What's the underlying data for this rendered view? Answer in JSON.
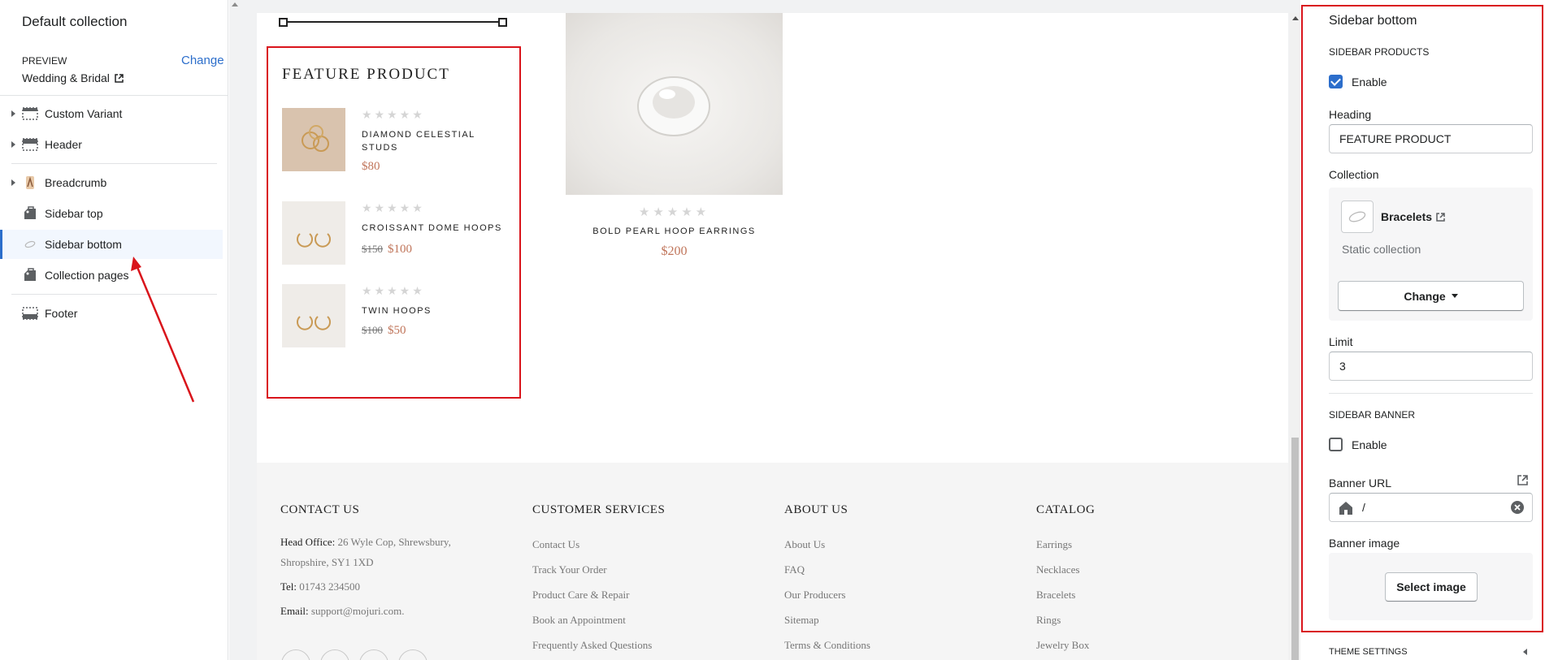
{
  "left_panel": {
    "collection_title": "Default collection",
    "preview_label": "PREVIEW",
    "preview_change": "Change",
    "preview_value": "Wedding & Bridal",
    "items": [
      {
        "label": "Custom Variant",
        "icon": "section-icon",
        "expandable": true
      },
      {
        "label": "Header",
        "icon": "header-icon",
        "expandable": true
      },
      {
        "label": "Breadcrumb",
        "icon": "image-icon",
        "expandable": true
      },
      {
        "label": "Sidebar top",
        "icon": "tag-icon",
        "expandable": false
      },
      {
        "label": "Sidebar bottom",
        "icon": "bracelet-thumb-icon",
        "expandable": false,
        "active": true
      },
      {
        "label": "Collection pages",
        "icon": "tag-icon",
        "expandable": false
      },
      {
        "label": "Footer",
        "icon": "footer-icon",
        "expandable": false
      }
    ]
  },
  "preview": {
    "feature": {
      "title": "FEATURE PRODUCT",
      "products": [
        {
          "name": "DIAMOND CELESTIAL STUDS",
          "price": "$80",
          "old_price": ""
        },
        {
          "name": "CROISSANT DOME HOOPS",
          "price": "$100",
          "old_price": "$150"
        },
        {
          "name": "TWIN HOOPS",
          "price": "$50",
          "old_price": "$100"
        }
      ],
      "stars": "★★★★★"
    },
    "product": {
      "name": "BOLD PEARL HOOP EARRINGS",
      "price": "$200",
      "stars": "★★★★★"
    },
    "footer": {
      "contact": {
        "heading": "CONTACT US",
        "office_label": "Head Office:",
        "office_value": "26 Wyle Cop, Shrewsbury, Shropshire, SY1 1XD",
        "tel_label": "Tel:",
        "tel_value": "01743 234500",
        "email_label": "Email:",
        "email_value": "support@mojuri.com."
      },
      "customer_services": {
        "heading": "CUSTOMER SERVICES",
        "links": [
          "Contact Us",
          "Track Your Order",
          "Product Care & Repair",
          "Book an Appointment",
          "Frequently Asked Questions"
        ]
      },
      "about": {
        "heading": "ABOUT US",
        "links": [
          "About Us",
          "FAQ",
          "Our Producers",
          "Sitemap",
          "Terms & Conditions"
        ]
      },
      "catalog": {
        "heading": "CATALOG",
        "links": [
          "Earrings",
          "Necklaces",
          "Bracelets",
          "Rings",
          "Jewelry Box"
        ]
      }
    }
  },
  "right_panel": {
    "title": "Sidebar bottom",
    "sidebar_products_heading": "SIDEBAR PRODUCTS",
    "products_enable_label": "Enable",
    "products_enabled": true,
    "heading_label": "Heading",
    "heading_value": "FEATURE PRODUCT",
    "collection_label": "Collection",
    "collection_name": "Bracelets",
    "collection_type": "Static collection",
    "change_button": "Change",
    "limit_label": "Limit",
    "limit_value": "3",
    "sidebar_banner_heading": "SIDEBAR BANNER",
    "banner_enable_label": "Enable",
    "banner_enabled": false,
    "banner_url_label": "Banner URL",
    "banner_url_value": "/",
    "banner_image_label": "Banner image",
    "select_image_button": "Select image",
    "theme_settings": "THEME SETTINGS"
  },
  "colors": {
    "accent": "#2c6ecb",
    "highlight_border": "#d9141b",
    "price": "#c0755a"
  }
}
